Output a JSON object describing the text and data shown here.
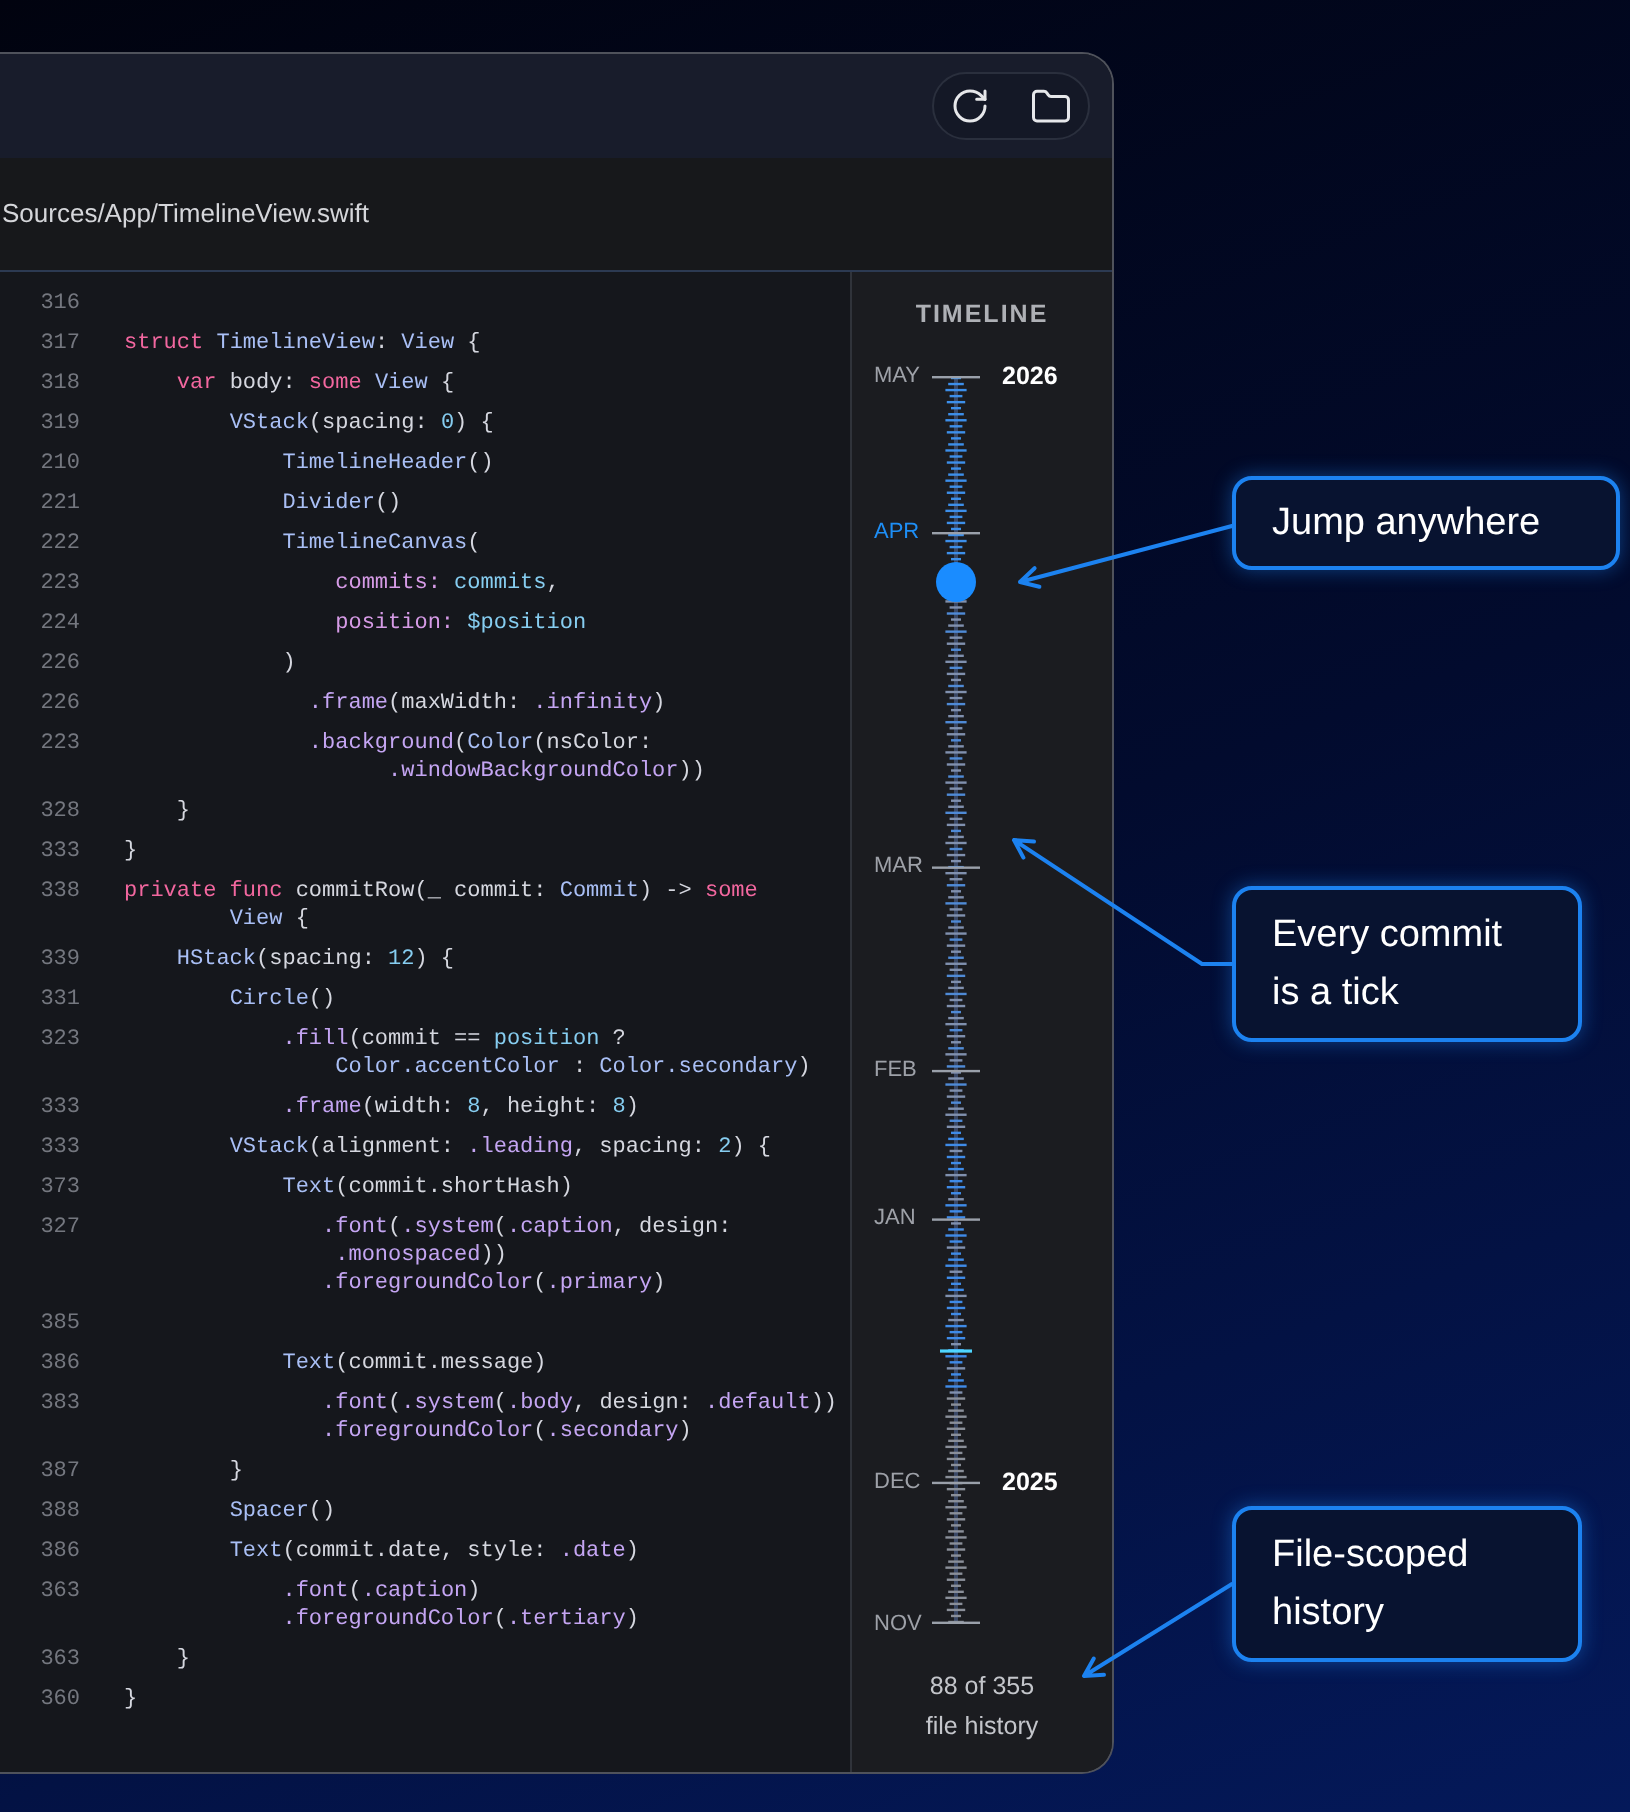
{
  "path_bar": {
    "path": "Sources/App/TimelineView.swift"
  },
  "editor": {
    "lines": [
      {
        "number": "316"
      },
      {
        "number": "317",
        "code": [
          [
            {
              "kind": "keyword",
              "text": "struct "
            },
            {
              "kind": "type",
              "text": "TimelineView"
            },
            {
              "kind": "plain",
              "text": ": "
            },
            {
              "kind": "type",
              "text": "View"
            },
            {
              "kind": "plain",
              "text": " {"
            }
          ]
        ]
      },
      {
        "number": "318",
        "code": [
          [
            {
              "kind": "keyword",
              "text": "    var "
            },
            {
              "kind": "plain",
              "text": "body: "
            },
            {
              "kind": "keyword",
              "text": "some "
            },
            {
              "kind": "type",
              "text": "View"
            },
            {
              "kind": "plain",
              "text": " {"
            }
          ]
        ]
      },
      {
        "number": "319",
        "code": [
          [
            {
              "kind": "type",
              "text": "        VStack"
            },
            {
              "kind": "plain",
              "text": "(spacing: "
            },
            {
              "kind": "value",
              "text": "0"
            },
            {
              "kind": "plain",
              "text": ") {"
            }
          ]
        ]
      },
      {
        "number": "210",
        "code": [
          [
            {
              "kind": "type",
              "text": "            TimelineHeader"
            },
            {
              "kind": "plain",
              "text": "()"
            }
          ]
        ]
      },
      {
        "number": "221",
        "code": [
          [
            {
              "kind": "type",
              "text": "            Divider"
            },
            {
              "kind": "plain",
              "text": "()"
            }
          ]
        ]
      },
      {
        "number": "222",
        "code": [
          [
            {
              "kind": "type",
              "text": "            TimelineCanvas"
            },
            {
              "kind": "plain",
              "text": "("
            }
          ]
        ]
      },
      {
        "number": "223",
        "code": [
          [
            {
              "kind": "param",
              "text": "                commits: "
            },
            {
              "kind": "value",
              "text": "commits"
            },
            {
              "kind": "plain",
              "text": ","
            }
          ]
        ]
      },
      {
        "number": "224",
        "code": [
          [
            {
              "kind": "param",
              "text": "                position: "
            },
            {
              "kind": "value",
              "text": "$position"
            }
          ]
        ]
      },
      {
        "number": "226",
        "code": [
          [
            {
              "kind": "plain",
              "text": "            )"
            }
          ]
        ]
      },
      {
        "number": "226",
        "code": [
          [
            {
              "kind": "member",
              "text": "              .frame"
            },
            {
              "kind": "plain",
              "text": "(maxWidth: "
            },
            {
              "kind": "member",
              "text": ".infinity"
            },
            {
              "kind": "plain",
              "text": ")"
            }
          ]
        ]
      },
      {
        "number": "223",
        "code": [
          [
            {
              "kind": "member",
              "text": "              .background"
            },
            {
              "kind": "plain",
              "text": "("
            },
            {
              "kind": "type",
              "text": "Color"
            },
            {
              "kind": "plain",
              "text": "(nsColor:"
            }
          ],
          [
            {
              "kind": "member",
              "text": "                    .windowBackgroundColor"
            },
            {
              "kind": "plain",
              "text": "))"
            }
          ]
        ]
      },
      {
        "number": "328",
        "code": [
          [
            {
              "kind": "plain",
              "text": "    }"
            }
          ]
        ]
      },
      {
        "number": "333",
        "code": [
          [
            {
              "kind": "plain",
              "text": "}"
            }
          ]
        ]
      },
      {
        "number": "338",
        "code": [
          [
            {
              "kind": "keyword",
              "text": "private func "
            },
            {
              "kind": "plain",
              "text": "commitRow(_ commit: "
            },
            {
              "kind": "type",
              "text": "Commit"
            },
            {
              "kind": "plain",
              "text": ") -> "
            },
            {
              "kind": "keyword",
              "text": "some"
            }
          ],
          [
            {
              "kind": "type",
              "text": "        View"
            },
            {
              "kind": "plain",
              "text": " {"
            }
          ]
        ]
      },
      {
        "number": "339",
        "code": [
          [
            {
              "kind": "type",
              "text": "    HStack"
            },
            {
              "kind": "plain",
              "text": "(spacing: "
            },
            {
              "kind": "value",
              "text": "12"
            },
            {
              "kind": "plain",
              "text": ") {"
            }
          ]
        ]
      },
      {
        "number": "331",
        "code": [
          [
            {
              "kind": "type",
              "text": "        Circle"
            },
            {
              "kind": "plain",
              "text": "()"
            }
          ]
        ]
      },
      {
        "number": "323",
        "code": [
          [
            {
              "kind": "member",
              "text": "            .fill"
            },
            {
              "kind": "plain",
              "text": "(commit == "
            },
            {
              "kind": "value",
              "text": "position"
            },
            {
              "kind": "plain",
              "text": " ?"
            }
          ],
          [
            {
              "kind": "type",
              "text": "                Color.accentColor"
            },
            {
              "kind": "plain",
              "text": " : "
            },
            {
              "kind": "type",
              "text": "Color.secondary"
            },
            {
              "kind": "plain",
              "text": ")"
            }
          ]
        ]
      },
      {
        "number": "333",
        "code": [
          [
            {
              "kind": "member",
              "text": "            .frame"
            },
            {
              "kind": "plain",
              "text": "(width: "
            },
            {
              "kind": "value",
              "text": "8"
            },
            {
              "kind": "plain",
              "text": ", height: "
            },
            {
              "kind": "value",
              "text": "8"
            },
            {
              "kind": "plain",
              "text": ")"
            }
          ]
        ]
      },
      {
        "number": "333",
        "code": [
          [
            {
              "kind": "type",
              "text": "        VStack"
            },
            {
              "kind": "plain",
              "text": "(alignment: "
            },
            {
              "kind": "member",
              "text": ".leading"
            },
            {
              "kind": "plain",
              "text": ", spacing: "
            },
            {
              "kind": "value",
              "text": "2"
            },
            {
              "kind": "plain",
              "text": ") {"
            }
          ]
        ]
      },
      {
        "number": "373",
        "code": [
          [
            {
              "kind": "type",
              "text": "            Text"
            },
            {
              "kind": "plain",
              "text": "(commit.shortHash)"
            }
          ]
        ]
      },
      {
        "number": "327",
        "code": [
          [
            {
              "kind": "member",
              "text": "               .font"
            },
            {
              "kind": "plain",
              "text": "("
            },
            {
              "kind": "member",
              "text": ".system"
            },
            {
              "kind": "plain",
              "text": "("
            },
            {
              "kind": "member",
              "text": ".caption"
            },
            {
              "kind": "plain",
              "text": ", design:"
            }
          ],
          [
            {
              "kind": "member",
              "text": "                .monospaced"
            },
            {
              "kind": "plain",
              "text": "))"
            }
          ],
          [
            {
              "kind": "member",
              "text": "               .foregroundColor"
            },
            {
              "kind": "plain",
              "text": "("
            },
            {
              "kind": "member",
              "text": ".primary"
            },
            {
              "kind": "plain",
              "text": ")"
            }
          ]
        ]
      },
      {
        "number": "385"
      },
      {
        "number": "386",
        "code": [
          [
            {
              "kind": "type",
              "text": "            Text"
            },
            {
              "kind": "plain",
              "text": "(commit.message)"
            }
          ]
        ]
      },
      {
        "number": "383",
        "code": [
          [
            {
              "kind": "member",
              "text": "               .font"
            },
            {
              "kind": "plain",
              "text": "("
            },
            {
              "kind": "member",
              "text": ".system"
            },
            {
              "kind": "plain",
              "text": "("
            },
            {
              "kind": "member",
              "text": ".body"
            },
            {
              "kind": "plain",
              "text": ", design: "
            },
            {
              "kind": "member",
              "text": ".default"
            },
            {
              "kind": "plain",
              "text": "))"
            }
          ],
          [
            {
              "kind": "member",
              "text": "               .foregroundColor"
            },
            {
              "kind": "plain",
              "text": "("
            },
            {
              "kind": "member",
              "text": ".secondary"
            },
            {
              "kind": "plain",
              "text": ")"
            }
          ]
        ]
      },
      {
        "number": "387",
        "code": [
          [
            {
              "kind": "plain",
              "text": "        }"
            }
          ]
        ]
      },
      {
        "number": "388",
        "code": [
          [
            {
              "kind": "type",
              "text": "        Spacer"
            },
            {
              "kind": "plain",
              "text": "()"
            }
          ]
        ]
      },
      {
        "number": "386",
        "code": [
          [
            {
              "kind": "type",
              "text": "        Text"
            },
            {
              "kind": "plain",
              "text": "(commit.date, style: "
            },
            {
              "kind": "member",
              "text": ".date"
            },
            {
              "kind": "plain",
              "text": ")"
            }
          ]
        ]
      },
      {
        "number": "363",
        "code": [
          [
            {
              "kind": "member",
              "text": "            .font"
            },
            {
              "kind": "plain",
              "text": "("
            },
            {
              "kind": "member",
              "text": ".caption"
            },
            {
              "kind": "plain",
              "text": ")"
            }
          ],
          [
            {
              "kind": "member",
              "text": "            .foregroundColor"
            },
            {
              "kind": "plain",
              "text": "("
            },
            {
              "kind": "member",
              "text": ".tertiary"
            },
            {
              "kind": "plain",
              "text": ")"
            }
          ]
        ]
      },
      {
        "number": "363",
        "code": [
          [
            {
              "kind": "plain",
              "text": "    }"
            }
          ]
        ]
      },
      {
        "number": "360",
        "code": [
          [
            {
              "kind": "plain",
              "text": "}"
            }
          ]
        ]
      }
    ]
  },
  "timeline": {
    "title": "TIMELINE",
    "level": 0.835,
    "months": [
      {
        "label": "MAY",
        "selected": false,
        "year": "2026"
      },
      {
        "label": "APR",
        "selected": true
      },
      {
        "label": "MAR",
        "selected": false
      },
      {
        "label": "FEB",
        "selected": false
      },
      {
        "label": "JAN",
        "selected": false
      },
      {
        "label": "DEC",
        "selected": false,
        "year": "2025"
      },
      {
        "label": "NOV",
        "selected": false
      }
    ],
    "count": "88 of 355",
    "caption": "file history"
  },
  "callouts": [
    {
      "text": "Jump anywhere"
    },
    {
      "text": "Every commit is a tick"
    },
    {
      "text": "File-scoped history"
    }
  ]
}
